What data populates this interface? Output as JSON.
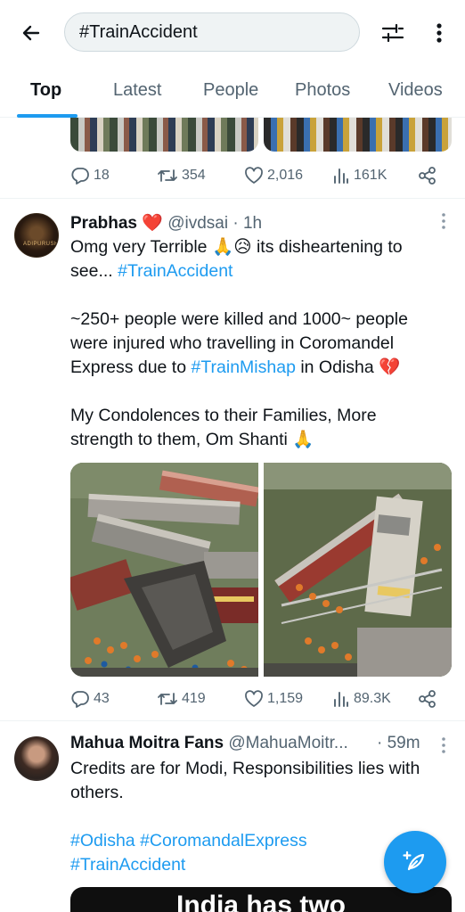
{
  "search": {
    "query": "#TrainAccident"
  },
  "tabs": [
    {
      "label": "Top"
    },
    {
      "label": "Latest"
    },
    {
      "label": "People"
    },
    {
      "label": "Photos"
    },
    {
      "label": "Videos"
    }
  ],
  "prev_tweet": {
    "replies": "18",
    "retweets": "354",
    "likes": "2,016",
    "views": "161K"
  },
  "tweet1": {
    "name": "Prabhas",
    "name_emoji": "❤️",
    "handle": "@ivdsai",
    "time": "· 1h",
    "avatar_text": "ADIPURUSH",
    "line1_a": "Omg very Terrible ",
    "line1_emoji": "🙏😥",
    "line1_b": " its disheartening to",
    "line2_a": "see... ",
    "line2_link": "#TrainAccident",
    "para2_line1": "~250+ people were killed and 1000~ people",
    "para2_line2": "were injured who travelling in Coromandel",
    "para2_line3_a": "Express due to ",
    "para2_line3_link": "#TrainMishap",
    "para2_line3_b": " in Odisha ",
    "para2_line3_emoji": "💔",
    "para3_line1": "My Condolences to their Families, More",
    "para3_line2_a": "strength to them, Om Shanti ",
    "para3_line2_emoji": "🙏",
    "replies": "43",
    "retweets": "419",
    "likes": "1,159",
    "views": "89.3K"
  },
  "tweet2": {
    "name": "Mahua Moitra Fans",
    "handle": "@MahuaMoitr...",
    "time": "· 59m",
    "line1": "Credits are for Modi, Responsibilities lies with",
    "line2": "others.",
    "hashtag1": "#Odisha",
    "hashtag2": "#CoromandalExpress",
    "hashtag3": "#TrainAccident",
    "image_text": "India has two"
  },
  "colors": {
    "accent": "#1d9bf0",
    "text": "#0f1419",
    "secondary": "#536471",
    "heart": "#e0245e"
  },
  "icons": {
    "back": "arrow-left-icon",
    "filter": "sliders-icon",
    "more": "vertical-dots-icon",
    "reply": "reply-bubble-icon",
    "retweet": "retweet-icon",
    "like": "heart-outline-icon",
    "views": "bar-chart-icon",
    "share": "share-icon",
    "compose": "feather-plus-icon"
  }
}
